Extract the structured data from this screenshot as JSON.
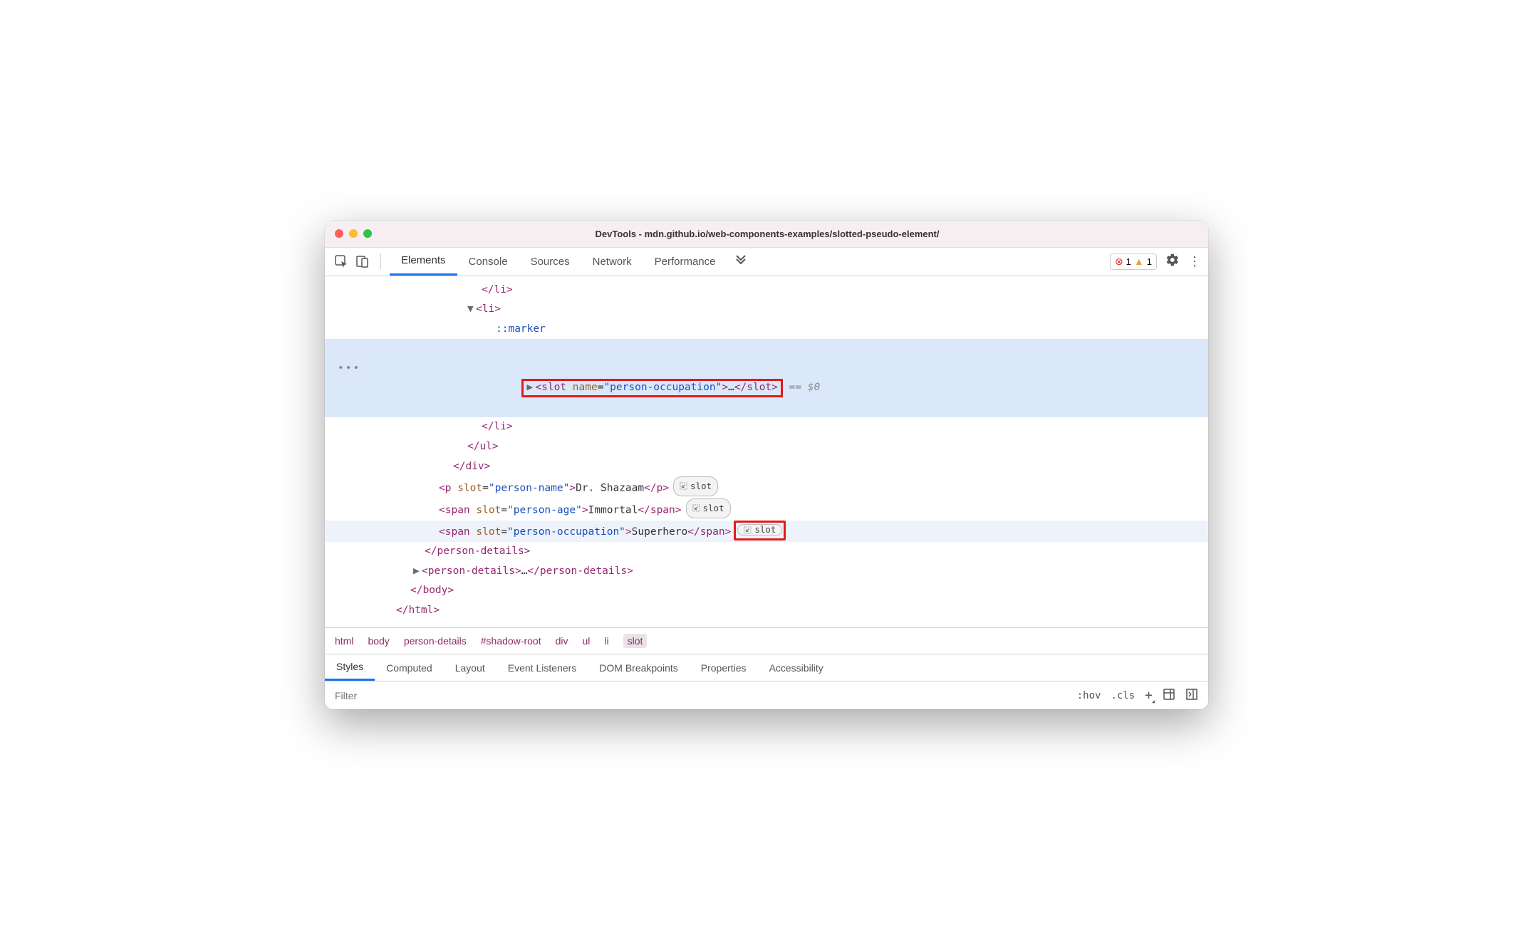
{
  "window": {
    "title": "DevTools - mdn.github.io/web-components-examples/slotted-pseudo-element/"
  },
  "tabs": {
    "elements": "Elements",
    "console": "Console",
    "sources": "Sources",
    "network": "Network",
    "performance": "Performance"
  },
  "issues": {
    "errors": "1",
    "warnings": "1"
  },
  "code": {
    "li_close1": "</li>",
    "li_open": "<li>",
    "marker": "::marker",
    "slot_open": "<slot",
    "slot_attr": " name",
    "slot_eq": "=",
    "slot_val": "\"person-occupation\"",
    "slot_gt": ">",
    "slot_ell": "…",
    "slot_close": "</slot>",
    "eq0": " == $0",
    "li_close2": "</li>",
    "ul_close": "</ul>",
    "div_close": "</div>",
    "p_tag_open": "<p",
    "p_attr": " slot",
    "p_val": "\"person-name\"",
    "p_text": "Dr. Shazaam",
    "p_close": "</p>",
    "s1_tag": "<span",
    "s1_attr": " slot",
    "s1_val": "\"person-age\"",
    "s1_text": "Immortal",
    "s1_close": "</span>",
    "s2_tag": "<span",
    "s2_attr": " slot",
    "s2_val": "\"person-occupation\"",
    "s2_text": "Superhero",
    "s2_close": "</span>",
    "pd_close": "</person-details>",
    "pd2": "<person-details>",
    "pd2_ell": "…",
    "pd2_close": "</person-details>",
    "body_close": "</body>",
    "html_close": "</html>",
    "slot_badge": "slot"
  },
  "breadcrumbs": [
    "html",
    "body",
    "person-details",
    "#shadow-root",
    "div",
    "ul",
    "li",
    "slot"
  ],
  "subtabs": [
    "Styles",
    "Computed",
    "Layout",
    "Event Listeners",
    "DOM Breakpoints",
    "Properties",
    "Accessibility"
  ],
  "filter": {
    "placeholder": "Filter",
    "hov": ":hov",
    "cls": ".cls"
  }
}
